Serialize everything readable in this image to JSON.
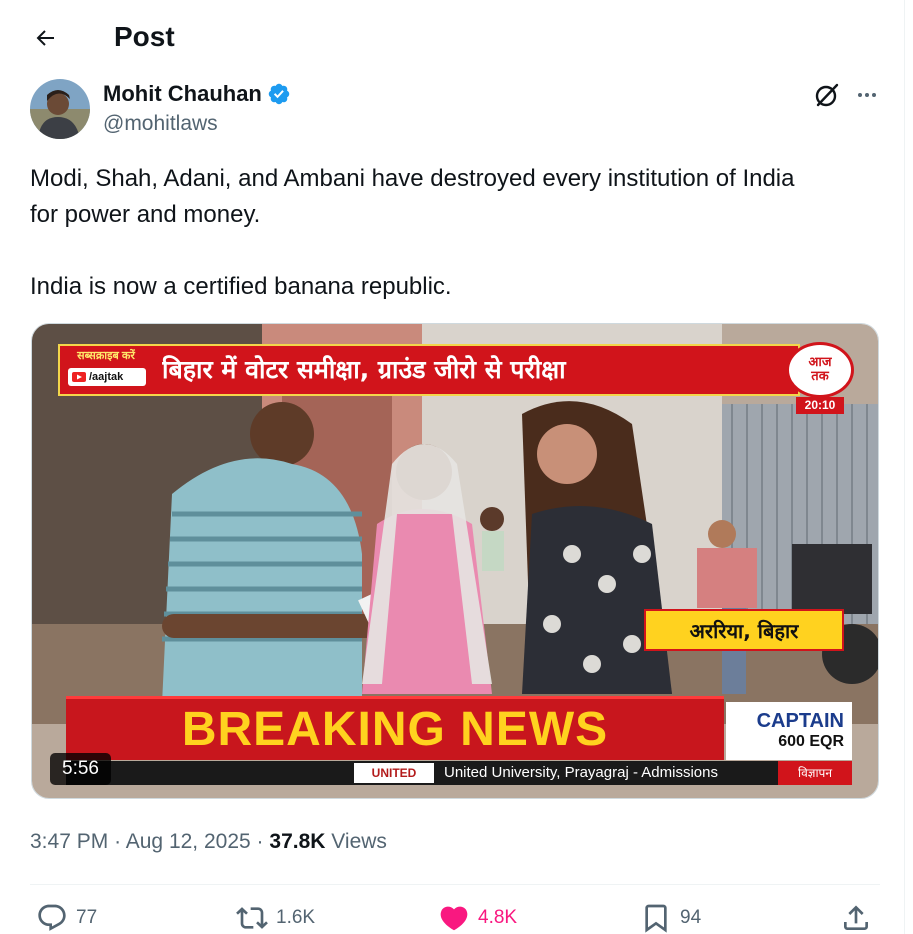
{
  "header": {
    "title": "Post"
  },
  "author": {
    "display_name": "Mohit Chauhan",
    "handle": "@mohitlaws",
    "verified": true
  },
  "tweet": {
    "lines": [
      "Modi, Shah, Adani, and Ambani have destroyed every institution of India",
      "for power and money.",
      "India is now a certified banana republic."
    ]
  },
  "video": {
    "duration": "5:56",
    "overlay": {
      "subscribe_label": "सब्सक्राइब करें",
      "channel_handle": "/aajtak",
      "headline": "बिहार में वोटर समीक्षा, ग्राउंड जीरो से परीक्षा",
      "logo_line1": "आज",
      "logo_line2": "तक",
      "clock": "20:10",
      "location": "अररिया, बिहार",
      "breaking": "BREAKING NEWS",
      "ad_brand_line1": "CAPTAIN",
      "ad_brand_line2": "600 EQR",
      "ticker_logo": "UNITED",
      "ticker_text": "United University, Prayagraj - Admissions",
      "ad_tag": "विज्ञापन"
    }
  },
  "meta": {
    "time": "3:47 PM",
    "separator": "·",
    "date": "Aug 12, 2025",
    "views_count": "37.8K",
    "views_label": "Views"
  },
  "actions": {
    "replies": "77",
    "reposts": "1.6K",
    "likes": "4.8K",
    "bookmarks": "94"
  },
  "colors": {
    "text_primary": "#0f1419",
    "text_secondary": "#536471",
    "like_pink": "#f91880",
    "verified_blue": "#1d9bf0",
    "breaking_red": "#c8161d",
    "breaking_yellow": "#ffd21f"
  },
  "icons": [
    "back-arrow-icon",
    "verified-badge-icon",
    "grok-icon",
    "more-icon",
    "reply-icon",
    "repost-icon",
    "like-icon",
    "bookmark-icon",
    "share-icon"
  ]
}
